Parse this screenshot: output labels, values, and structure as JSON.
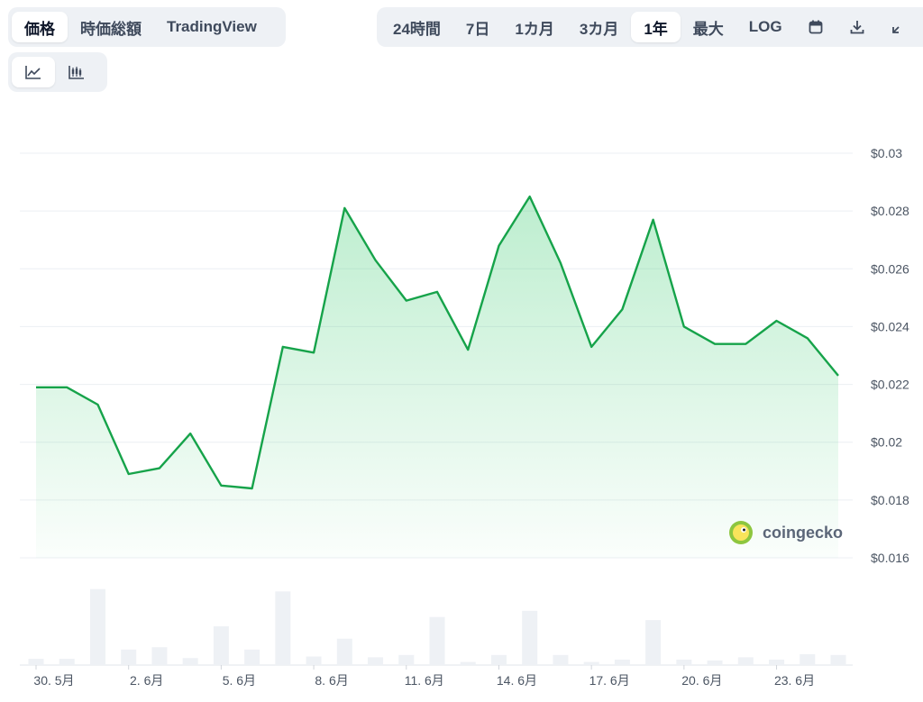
{
  "tabs_left": [
    {
      "label": "価格",
      "active": true
    },
    {
      "label": "時価総額",
      "active": false
    },
    {
      "label": "TradingView",
      "active": false
    }
  ],
  "tabs_range": [
    {
      "label": "24時間",
      "active": false
    },
    {
      "label": "7日",
      "active": false
    },
    {
      "label": "1カ月",
      "active": false
    },
    {
      "label": "3カ月",
      "active": false
    },
    {
      "label": "1年",
      "active": true
    },
    {
      "label": "最大",
      "active": false
    },
    {
      "label": "LOG",
      "active": false
    }
  ],
  "range_icons": [
    "calendar-icon",
    "download-icon",
    "expand-icon"
  ],
  "chart_type_icons": [
    {
      "icon": "line-chart-icon",
      "active": true
    },
    {
      "icon": "candlestick-icon",
      "active": false
    }
  ],
  "watermark": "coingecko",
  "colors": {
    "line": "#16a34a",
    "fill": "#22c55e",
    "volume": "#eef1f5",
    "grid": "#eceff3"
  },
  "chart_data": {
    "type": "line",
    "title": "",
    "xlabel": "",
    "ylabel": "",
    "ylim": [
      0.016,
      0.03
    ],
    "y_ticks": [
      "$0.03",
      "$0.028",
      "$0.026",
      "$0.024",
      "$0.022",
      "$0.02",
      "$0.018",
      "$0.016"
    ],
    "y_tick_values": [
      0.03,
      0.028,
      0.026,
      0.024,
      0.022,
      0.02,
      0.018,
      0.016
    ],
    "x_tick_labels": [
      "30. 5月",
      "2. 6月",
      "5. 6月",
      "8. 6月",
      "11. 6月",
      "14. 6月",
      "17. 6月",
      "20. 6月",
      "23. 6月"
    ],
    "x_tick_index": [
      0,
      3,
      6,
      9,
      12,
      15,
      18,
      21,
      24
    ],
    "price": [
      0.0219,
      0.0219,
      0.0213,
      0.0189,
      0.0191,
      0.0203,
      0.0185,
      0.0184,
      0.0233,
      0.0231,
      0.0281,
      0.0263,
      0.0249,
      0.0252,
      0.0232,
      0.0268,
      0.0285,
      0.0262,
      0.0233,
      0.0246,
      0.0277,
      0.024,
      0.0234,
      0.0234,
      0.0242,
      0.0236,
      0.0223
    ],
    "volume_relative": [
      0.08,
      0.08,
      0.98,
      0.2,
      0.23,
      0.09,
      0.5,
      0.2,
      0.95,
      0.11,
      0.34,
      0.1,
      0.13,
      0.62,
      0.04,
      0.13,
      0.7,
      0.13,
      0.04,
      0.07,
      0.58,
      0.07,
      0.06,
      0.1,
      0.07,
      0.14,
      0.13
    ]
  }
}
